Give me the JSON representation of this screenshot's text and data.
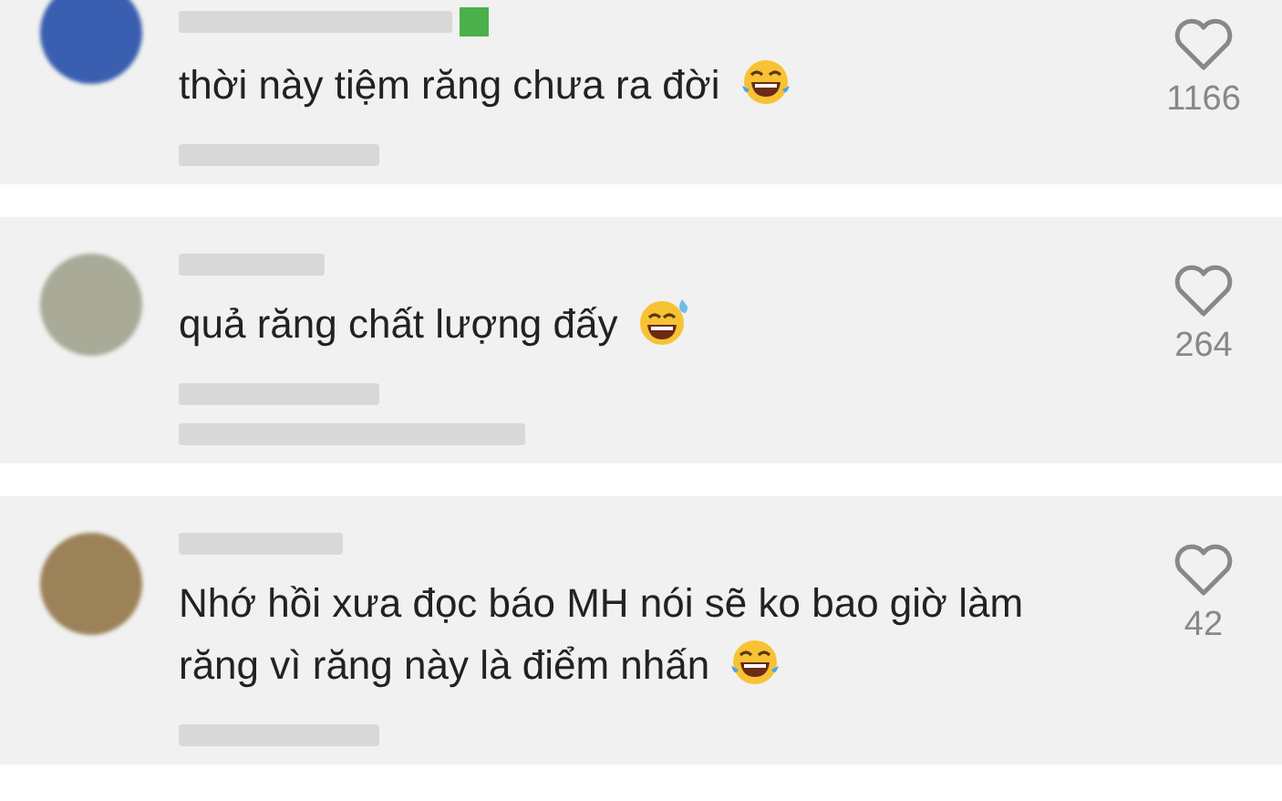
{
  "comments": [
    {
      "text": "thời này tiệm răng chưa ra đời",
      "emoji": {
        "kind": "laughing"
      },
      "likes": "1166",
      "verified": true,
      "replies_blurred": false,
      "avatar": {
        "color": "#3a5fb0"
      }
    },
    {
      "text": "quả răng chất lượng đấy",
      "emoji": {
        "kind": "sweat"
      },
      "likes": "264",
      "verified": false,
      "replies_blurred": true,
      "avatar": {
        "color": "#a9ab98"
      }
    },
    {
      "text": "Nhớ hồi xưa đọc báo MH nói sẽ ko bao giờ làm răng vì răng này là điểm nhấn",
      "emoji": {
        "kind": "laughing"
      },
      "likes": "42",
      "verified": false,
      "replies_blurred": false,
      "avatar": {
        "color": "#9c8258"
      }
    }
  ]
}
